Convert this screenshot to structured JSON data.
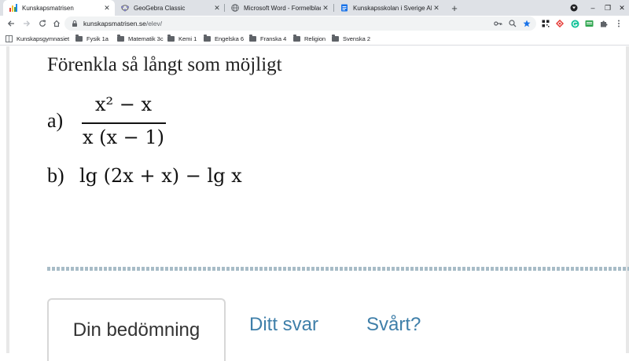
{
  "browser": {
    "tabs": [
      {
        "title": "Kunskapsmatrisen",
        "icon": "kunskapsmatrisen-favicon",
        "active": true
      },
      {
        "title": "GeoGebra Classic",
        "icon": "geogebra-favicon",
        "active": false
      },
      {
        "title": "Microsoft Word - Formelblad ma",
        "icon": "globe-icon",
        "active": false
      },
      {
        "title": "Kunskapsskolan i Sverige AB - I",
        "icon": "docs-favicon",
        "active": false
      }
    ],
    "close_symbol": "✕",
    "new_tab_symbol": "+",
    "window_controls": {
      "minimize": "–",
      "restore": "❐",
      "close": "✕"
    },
    "url_host": "kunskapsmatrisen.se",
    "url_path": "/elev/",
    "bookmarks": [
      {
        "label": "Kunskapsgymnasiet",
        "icon": "apps-grid-icon"
      },
      {
        "label": "Fysik 1a",
        "icon": "folder-icon"
      },
      {
        "label": "Matematik 3c",
        "icon": "folder-icon"
      },
      {
        "label": "Kemi 1",
        "icon": "folder-icon"
      },
      {
        "label": "Engelska 6",
        "icon": "folder-icon"
      },
      {
        "label": "Franska 4",
        "icon": "folder-icon"
      },
      {
        "label": "Religion",
        "icon": "folder-icon"
      },
      {
        "label": "Svenska 2",
        "icon": "folder-icon"
      }
    ]
  },
  "task": {
    "heading": "Förenkla så långt som möjligt",
    "part_a_label": "a)",
    "part_b_label": "b)",
    "numerator": "x² − x",
    "denominator": "x (x − 1)",
    "expression_b": "lg (2x + x) − lg  x"
  },
  "tabs": {
    "active": "Din bedömning",
    "answer": "Ditt svar",
    "hard": "Svårt?"
  },
  "colors": {
    "link": "#3f7fa9",
    "divider": "#a8bcc7",
    "tab_border": "#d7d7d7"
  }
}
